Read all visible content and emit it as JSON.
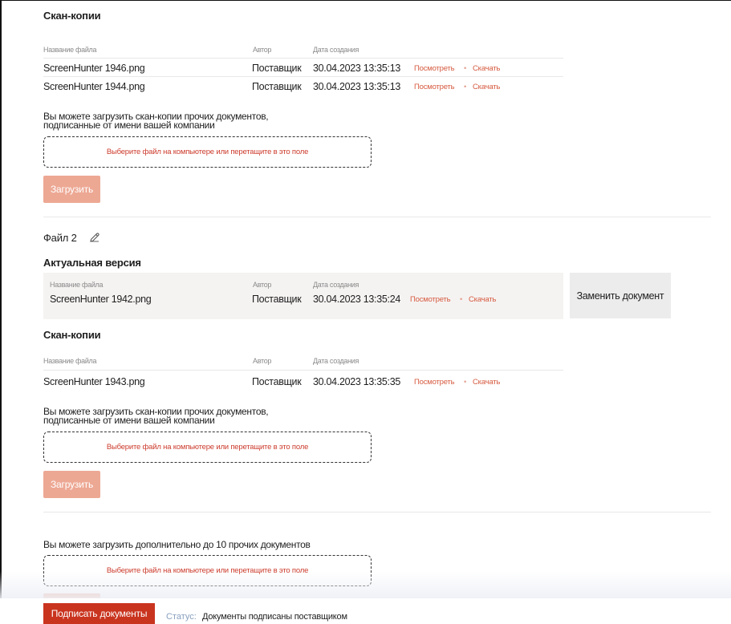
{
  "section1": {
    "title": "Скан-копии",
    "headers": {
      "name": "Название файла",
      "author": "Автор",
      "date": "Дата создания"
    },
    "rows": [
      {
        "name": "ScreenHunter 1946.png",
        "author": "Поставщик",
        "date": "30.04.2023 13:35:13",
        "view": "Посмотреть",
        "download": "Скачать"
      },
      {
        "name": "ScreenHunter 1944.png",
        "author": "Поставщик",
        "date": "30.04.2023 13:35:13",
        "view": "Посмотреть",
        "download": "Скачать"
      }
    ],
    "note_line1": "Вы можете загрузить скан-копии прочих документов,",
    "note_line2": "подписанные от имени вашей компании",
    "dropzone": "Выберите файл на компьютере или перетащите в это поле",
    "upload": "Загрузить"
  },
  "file2": {
    "title": "Файл 2",
    "actual_title": "Актуальная версия",
    "headers": {
      "name": "Название файла",
      "author": "Автор",
      "date": "Дата создания"
    },
    "actual_row": {
      "name": "ScreenHunter 1942.png",
      "author": "Поставщик",
      "date": "30.04.2023 13:35:24",
      "view": "Посмотреть",
      "download": "Скачать"
    },
    "replace": "Заменить документ"
  },
  "section2": {
    "title": "Скан-копии",
    "headers": {
      "name": "Название файла",
      "author": "Автор",
      "date": "Дата создания"
    },
    "rows": [
      {
        "name": "ScreenHunter 1943.png",
        "author": "Поставщик",
        "date": "30.04.2023 13:35:35",
        "view": "Посмотреть",
        "download": "Скачать"
      }
    ],
    "note_line1": "Вы можете загрузить скан-копии прочих документов,",
    "note_line2": "подписанные от имени вашей компании",
    "dropzone": "Выберите файл на компьютере или перетащите в это поле",
    "upload": "Загрузить"
  },
  "extra": {
    "note": "Вы можете загрузить дополнительно до 10 прочих документов",
    "dropzone": "Выберите файл на компьютере или перетащите в это поле"
  },
  "footer": {
    "sign": "Подписать документы",
    "status_label": "Статус:",
    "status": "Документы подписаны поставщиком"
  },
  "icons": {
    "edit": "pencil-icon"
  },
  "colors": {
    "accent": "#c9341f",
    "link": "#d65a3f",
    "upload_disabled": "#eda894"
  }
}
